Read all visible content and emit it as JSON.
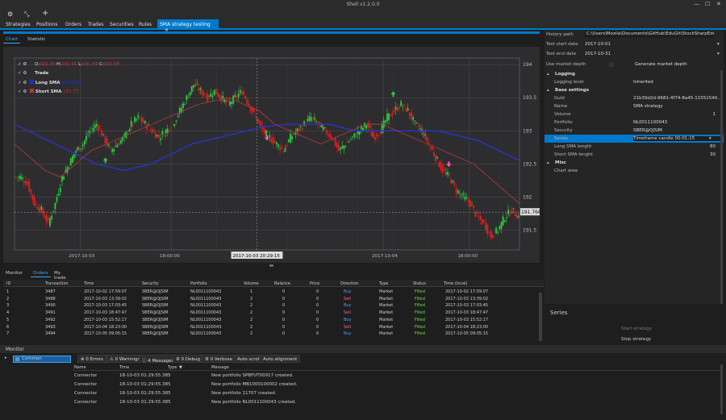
{
  "window": {
    "title": "Shell v1.2.0.0"
  },
  "toolbar": {
    "icons": [
      "gear-icon",
      "shrink-icon",
      "plus-icon"
    ]
  },
  "tabs": [
    {
      "label": "Strategies"
    },
    {
      "label": "Positions"
    },
    {
      "label": "Orders"
    },
    {
      "label": "Trades"
    },
    {
      "label": "Securities"
    },
    {
      "label": "Rules"
    },
    {
      "label": "SMA strategy testing",
      "active": true,
      "close": "×"
    }
  ],
  "chart_tabs": {
    "chart": "Chart",
    "statistic": "Statistic"
  },
  "legend": {
    "ohlc": {
      "o_label": "O:",
      "o": "191.76",
      "h_label": "H:",
      "h": "191.91",
      "l_label": "L:",
      "l": "191.59",
      "c_label": "C:",
      "c": "191.68"
    },
    "trade": "Trade",
    "long": "Long SMA",
    "long_val": "192.1656",
    "short": "Short SMA",
    "short_val": "191.77"
  },
  "chart_data": {
    "type": "candlestick",
    "y_ticks": [
      "194",
      "193.5",
      "193",
      "192.5",
      "192",
      "191.5"
    ],
    "x_ticks": [
      "2017-10-03",
      "18:00:00",
      "2017-10-04",
      "18:00:00"
    ],
    "crosshair_time": "2017-10-03 20:29:15",
    "price_label": "191.7684",
    "ylim": [
      191.2,
      194.1
    ],
    "closes": [
      192.3,
      192.2,
      191.9,
      191.8,
      191.6,
      191.9,
      192.3,
      192.5,
      192.7,
      192.8,
      193.0,
      193.1,
      192.9,
      192.7,
      192.8,
      192.9,
      193.1,
      193.2,
      193.1,
      193.0,
      192.9,
      193.0,
      193.1,
      193.3,
      193.5,
      193.7,
      193.6,
      193.5,
      193.6,
      193.5,
      193.4,
      193.5,
      193.6,
      193.4,
      193.2,
      193.0,
      192.9,
      192.8,
      192.7,
      192.9,
      193.0,
      193.1,
      193.2,
      193.1,
      193.0,
      192.9,
      192.7,
      192.8,
      192.9,
      193.0,
      193.1,
      192.9,
      193.0,
      193.2,
      193.3,
      193.4,
      193.3,
      193.1,
      193.0,
      192.8,
      192.6,
      192.4,
      192.3,
      192.1,
      192.0,
      191.9,
      191.7,
      191.6,
      191.4,
      191.5,
      191.7,
      191.8,
      191.7
    ],
    "long_sma": [
      193.1,
      193.0,
      192.9,
      192.8,
      192.7,
      192.6,
      192.5,
      192.45,
      192.4,
      192.45,
      192.5,
      192.6,
      192.7,
      192.8,
      192.85,
      192.9,
      192.95,
      193.0,
      193.05,
      193.08,
      193.1,
      193.1,
      193.1,
      193.1,
      193.05,
      193.0,
      193.0,
      193.0,
      193.0,
      193.0,
      193.0,
      193.0,
      192.95,
      192.9,
      192.85,
      192.75,
      192.65,
      192.55
    ],
    "short_sma": [
      192.8,
      192.6,
      192.4,
      192.3,
      192.5,
      192.7,
      192.8,
      192.9,
      193.0,
      193.1,
      193.2,
      193.3,
      193.4,
      193.45,
      193.5,
      193.4,
      193.3,
      193.1,
      193.0,
      192.9,
      192.8,
      192.9,
      193.0,
      193.1,
      193.1,
      193.0,
      192.9,
      192.8,
      192.7,
      192.6,
      192.5,
      192.3,
      192.1,
      191.9
    ],
    "buy_signals": [
      [
        0.18,
        192.55
      ],
      [
        0.75,
        193.55
      ]
    ],
    "sell_signals": [
      [
        0.5,
        192.9
      ],
      [
        0.86,
        192.5
      ]
    ]
  },
  "bottom_tabs": [
    "Monitor",
    "Orders",
    "My trade"
  ],
  "grid": {
    "columns": [
      "ID",
      "Transaction",
      "Time",
      "Security",
      "Portfolio",
      "Volume",
      "Balance",
      "Price",
      "Direction",
      "Type",
      "Status",
      "Time (local)"
    ],
    "rows": [
      [
        "1",
        "3487",
        "2017-10-02 17:59:07",
        "SBER@QJSIM",
        "NL0011100043",
        "1",
        "0",
        "0",
        "Buy",
        "Market",
        "Filled",
        "2017-10-02 17:59:07"
      ],
      [
        "2",
        "3488",
        "2017-10-03 13:39:02",
        "SBER@QJSIM",
        "NL0011100043",
        "2",
        "0",
        "0",
        "Sell",
        "Market",
        "Filled",
        "2017-10-03 13:39:02"
      ],
      [
        "3",
        "3490",
        "2017-10-03 17:03:45",
        "SBER@QJSIM",
        "NL0011100043",
        "2",
        "0",
        "0",
        "Buy",
        "Market",
        "Filled",
        "2017-10-03 17:03:45"
      ],
      [
        "4",
        "3491",
        "2017-10-03 18:47:47",
        "SBER@QJSIM",
        "NL0011100043",
        "2",
        "0",
        "0",
        "Sell",
        "Market",
        "Filled",
        "2017-10-03 18:47:47"
      ],
      [
        "5",
        "3492",
        "2017-10-03 15:52:17",
        "SBER@QJSIM",
        "NL0011100043",
        "2",
        "0",
        "0",
        "Buy",
        "Market",
        "Filled",
        "2017-10-03 15:52:17"
      ],
      [
        "6",
        "3493",
        "2017-10-04 18:23:00",
        "SBER@QJSIM",
        "NL0011100043",
        "2",
        "0",
        "0",
        "Sell",
        "Market",
        "Filled",
        "2017-10-04 18:23:00"
      ],
      [
        "7",
        "3494",
        "2017-10-05 09:05:15",
        "SBER@QJSIM",
        "NL0011100043",
        "2",
        "0",
        "0",
        "Buy",
        "Market",
        "Filled",
        "2017-10-05 09:05:15"
      ]
    ]
  },
  "right": {
    "history_label": "History path",
    "history_value": "C:\\Users\\Mozila\\Documents\\GitHub\\EduGit\\StockSharpEdu",
    "start_label": "Test start date",
    "start_value": "2017-10-01",
    "end_label": "Test end date",
    "end_value": "2017-10-31",
    "use_depth": "Use market depth",
    "gen_depth": "Generate market depth",
    "props": [
      {
        "cat": "Logging"
      },
      {
        "k": "Logging level",
        "v": "Inherited"
      },
      {
        "cat": "Base settings"
      },
      {
        "k": "Guid",
        "v": "21b39d2d-9681-4f74-8a45-11551540..."
      },
      {
        "k": "Name",
        "v": "SMA strategy"
      },
      {
        "k": "Volume",
        "v": "1",
        "right": true
      },
      {
        "k": "Portfolio",
        "v": "NL0011100043"
      },
      {
        "k": "Security",
        "v": "SBER@QJSIM"
      },
      {
        "k": "Series",
        "v": "Timeframe candle 00:01:15",
        "sel": true
      },
      {
        "k": "Long SMA lenght",
        "v": "80",
        "right": true
      },
      {
        "k": "Short SMA lenght",
        "v": "30",
        "right": true
      },
      {
        "cat": "Misc"
      },
      {
        "k": "Chart area",
        "v": ""
      }
    ],
    "series_caption": "Series",
    "start_strategy": "Start strategy",
    "stop_strategy": "Stop strategy"
  },
  "monitor": {
    "title": "Monitor",
    "tree_item": "Common",
    "chips": [
      "0 Errors",
      "0 Warnings",
      "4 Messages",
      "0 Debug",
      "0 Verbose"
    ],
    "auto_scroll": "Auto scroll",
    "auto_align": "Auto alignment",
    "columns": [
      "Name",
      "Time",
      "Type",
      "Message"
    ],
    "rows": [
      [
        "Connector",
        "18-10-03 01:29:55.385",
        "",
        "New portfolio SPBFUT00917 created."
      ],
      [
        "Connector",
        "18-10-03 01:29:55.385",
        "",
        "New portfolio MB1000100002 created."
      ],
      [
        "Connector",
        "18-10-03 01:29:55.385",
        "",
        "New portfolio 11707 created."
      ],
      [
        "Connector",
        "18-10-03 01:29:55.385",
        "",
        "New portfolio NL0011100043 created."
      ]
    ]
  }
}
